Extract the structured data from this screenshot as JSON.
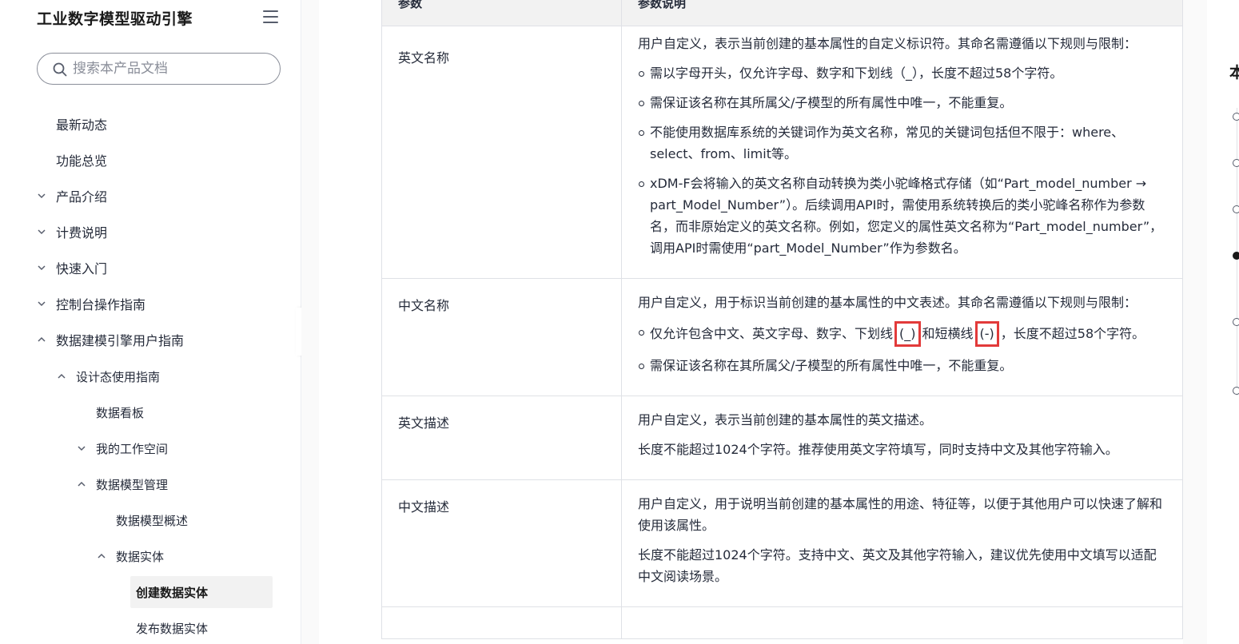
{
  "sidebar": {
    "title": "工业数字模型驱动引擎",
    "search_placeholder": "搜索本产品文档",
    "items": [
      {
        "label": "最新动态"
      },
      {
        "label": "功能总览"
      },
      {
        "label": "产品介绍",
        "chevron": "down"
      },
      {
        "label": "计费说明",
        "chevron": "down"
      },
      {
        "label": "快速入门",
        "chevron": "down"
      },
      {
        "label": "控制台操作指南",
        "chevron": "down"
      },
      {
        "label": "数据建模引擎用户指南",
        "chevron": "up"
      },
      {
        "label": "设计态使用指南",
        "chevron": "up"
      },
      {
        "label": "数据看板"
      },
      {
        "label": "我的工作空间",
        "chevron": "down"
      },
      {
        "label": "数据模型管理",
        "chevron": "up"
      },
      {
        "label": "数据模型概述"
      },
      {
        "label": "数据实体",
        "chevron": "up"
      },
      {
        "label": "创建数据实体",
        "active": true
      },
      {
        "label": "发布数据实体"
      }
    ]
  },
  "table": {
    "headers": [
      "参数",
      "参数说明"
    ],
    "rows": [
      {
        "name": "英文名称",
        "intro": "用户自定义，表示当前创建的基本属性的自定义标识符。其命名需遵循以下规则与限制：",
        "bullets": [
          "需以字母开头，仅允许字母、数字和下划线（_），长度不超过58个字符。",
          "需保证该名称在其所属父/子模型的所有属性中唯一，不能重复。",
          "不能使用数据库系统的关键词作为英文名称，常见的关键词包括但不限于：where、select、from、limit等。",
          "xDM-F会将输入的英文名称自动转换为类小驼峰格式存储（如“Part_model_number → part_Model_Number”）。后续调用API时，需使用系统转换后的类小驼峰名称作为参数名，而非原始定义的英文名称。例如，您定义的属性英文名称为“Part_model_number”，调用API时需使用“part_Model_Number”作为参数名。"
        ]
      },
      {
        "name": "中文名称",
        "intro": "用户自定义，用于标识当前创建的基本属性的中文表述。其命名需遵循以下规则与限制：",
        "bullet1_a": "仅允许包含中文、英文字母、数字、下划线",
        "bullet1_hl1": "(_)",
        "bullet1_b": "和短横线",
        "bullet1_hl2": "(-)",
        "bullet1_c": "，长度不超过58个字符。",
        "bullet2": "需保证该名称在其所属父/子模型的所有属性中唯一，不能重复。"
      },
      {
        "name": "英文描述",
        "p1": "用户自定义，表示当前创建的基本属性的英文描述。",
        "p2": "长度不能超过1024个字符。推荐使用英文字符填写，同时支持中文及其他字符输入。"
      },
      {
        "name": "中文描述",
        "p1": "用户自定义，用于说明当前创建的基本属性的用途、特征等，以便于其他用户可以快速了解和使用该属性。",
        "p2": "长度不能超过1024个字符。支持中文、英文及其他字符输入，建议优先使用中文填写以适配中文阅读场景。"
      }
    ]
  },
  "toc": {
    "title": "本",
    "active_index": 3
  },
  "colors": {
    "highlight_border": "#e23a3a",
    "active_nav_bg": "#f2f2f2",
    "table_border": "#dfe1e6"
  }
}
